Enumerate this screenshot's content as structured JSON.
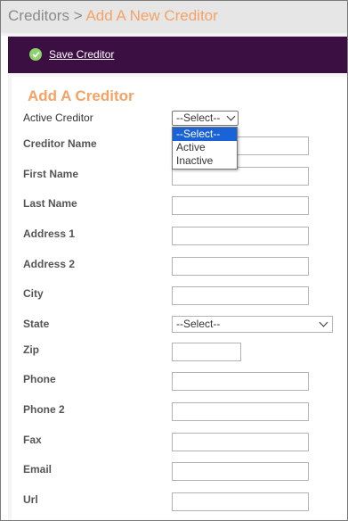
{
  "breadcrumb": {
    "root": "Creditors",
    "separator": ">",
    "current": "Add A New Creditor"
  },
  "toolbar": {
    "save_label": "Save Creditor",
    "save_icon": "check-circle-icon"
  },
  "form": {
    "title": "Add A Creditor",
    "active_creditor": {
      "label": "Active Creditor",
      "selected": "--Select--",
      "options": [
        "--Select--",
        "Active",
        "Inactive"
      ],
      "highlighted_option": "--Select--"
    },
    "fields": [
      {
        "label": "Creditor Name",
        "value": ""
      },
      {
        "label": "First Name",
        "value": ""
      },
      {
        "label": "Last Name",
        "value": ""
      },
      {
        "label": "Address 1",
        "value": ""
      },
      {
        "label": "Address 2",
        "value": ""
      },
      {
        "label": "City",
        "value": ""
      }
    ],
    "state": {
      "label": "State",
      "selected": "--Select--"
    },
    "fields2": [
      {
        "label": "Zip",
        "value": ""
      },
      {
        "label": "Phone",
        "value": ""
      },
      {
        "label": "Phone 2",
        "value": ""
      },
      {
        "label": "Fax",
        "value": ""
      },
      {
        "label": "Email",
        "value": ""
      },
      {
        "label": "Url",
        "value": ""
      }
    ]
  },
  "colors": {
    "accent_orange": "#f4a266",
    "toolbar_purple": "#3c0f42",
    "highlight_blue": "#1a63d6",
    "save_icon_green": "#8cd36b"
  }
}
